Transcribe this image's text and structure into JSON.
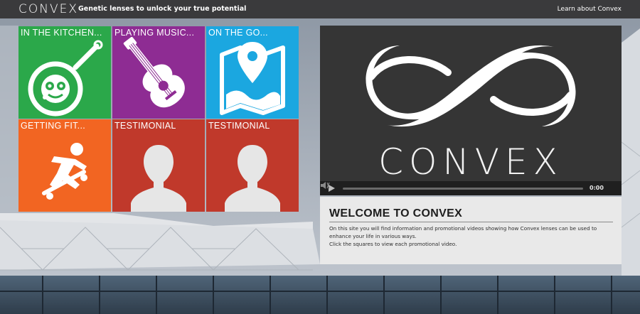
{
  "header": {
    "logo_text": "CONVEX",
    "tagline": "Genetic lenses to unlock your true potential",
    "learn_link": "Learn about Convex"
  },
  "tiles": [
    {
      "label": "IN THE KITCHEN...",
      "color": "#2ba84a",
      "icon": "frying-pan-face-icon"
    },
    {
      "label": "PLAYING MUSIC...",
      "color": "#8e2c93",
      "icon": "guitar-icon"
    },
    {
      "label": "ON THE GO...",
      "color": "#1ba7e0",
      "icon": "map-pin-icon"
    },
    {
      "label": "GETTING FIT...",
      "color": "#f26522",
      "icon": "skateboarder-icon"
    },
    {
      "label": "TESTIMONIAL",
      "color": "#c0392b",
      "icon": "person-silhouette-icon"
    },
    {
      "label": "TESTIMONIAL",
      "color": "#c0392b",
      "icon": "person-silhouette-icon"
    }
  ],
  "video": {
    "wordmark": "CONVEX",
    "time": "0:00",
    "progress": 0
  },
  "welcome": {
    "title": "WELCOME TO CONVEX",
    "line1": "On this site you will find information and promotional videos showing how Convex lenses can be used to enhance your life in various ways.",
    "line2": "Click the squares to view each promotional video."
  }
}
